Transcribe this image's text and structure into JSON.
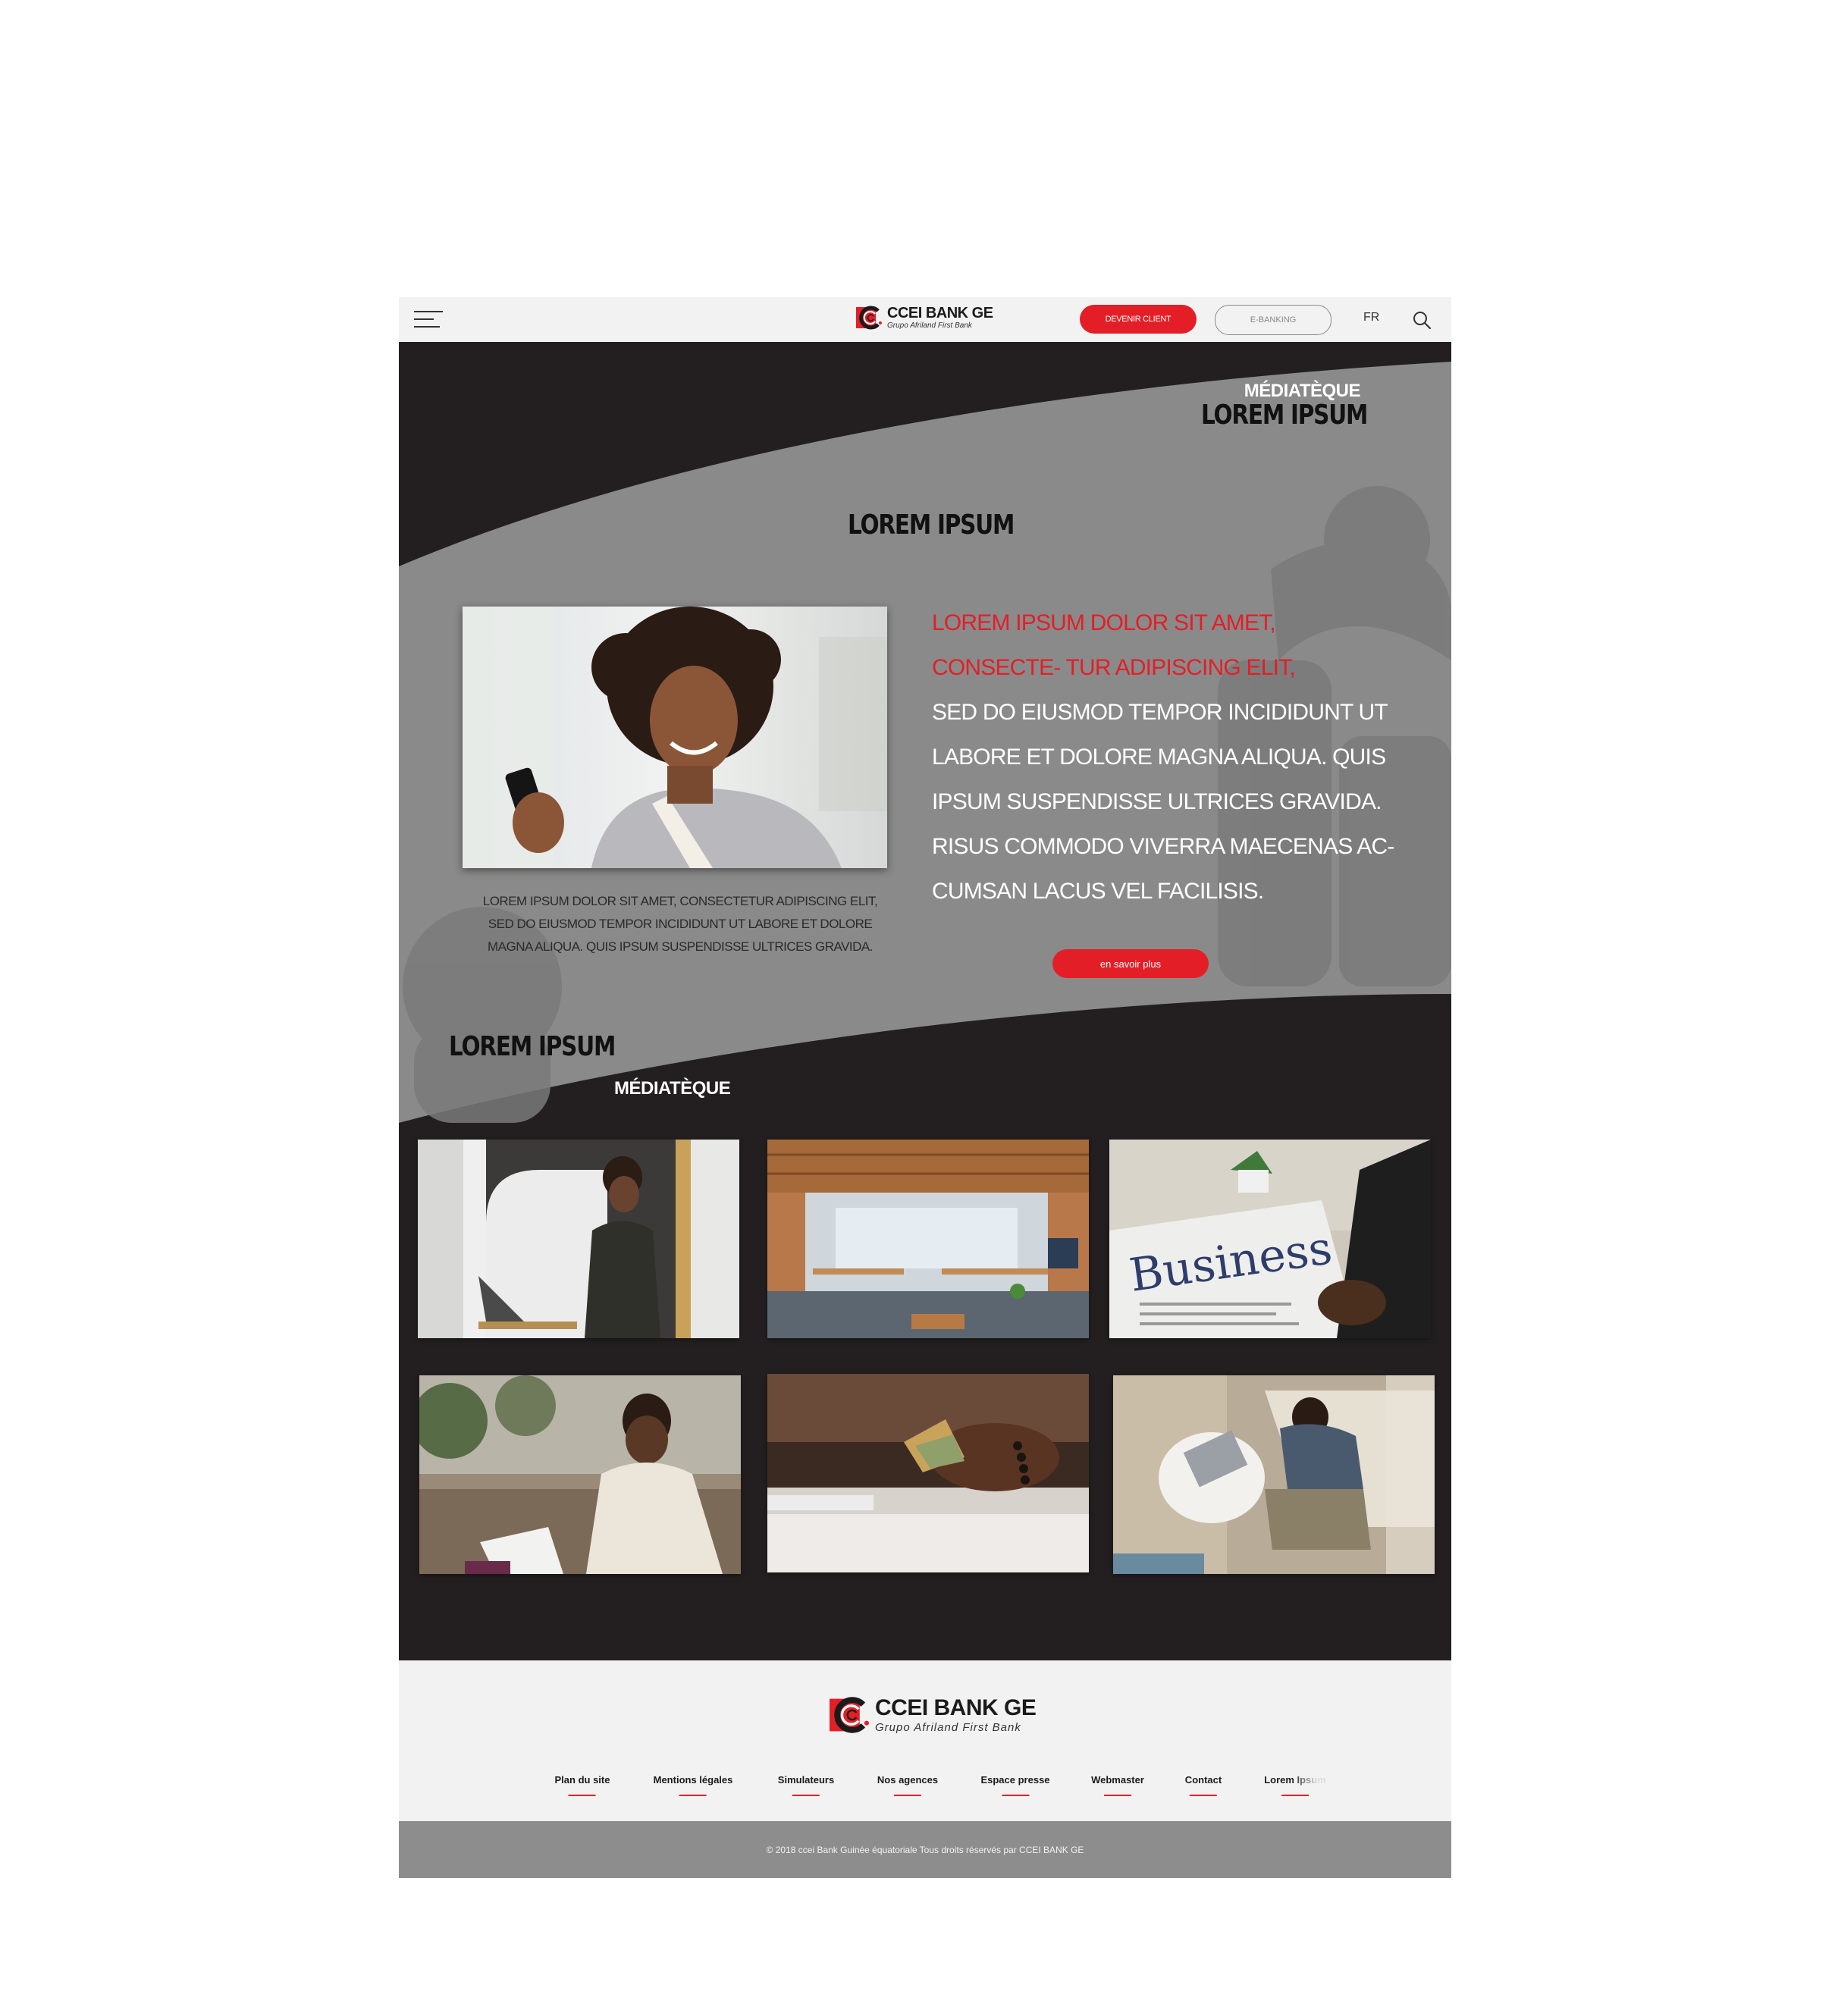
{
  "colors": {
    "brand_red": "#e41e26",
    "dark": "#231f20",
    "grey": "#8a8a8a",
    "light": "#f2f2f2"
  },
  "header": {
    "menu_icon": "hamburger-icon",
    "logo": {
      "title": "CCEI BANK GE",
      "subtitle": "Grupo Afriland First Bank"
    },
    "become_client_label": "DEVENIR CLIENT",
    "ebanking_label": "E-BANKING",
    "language": "FR",
    "search_icon": "search-icon"
  },
  "hero": {
    "kicker_top": "MÉDIATÈQUE",
    "heading_top": "LOREM IPSUM",
    "heading_center": "LOREM IPSUM",
    "caption": "LOREM IPSUM DOLOR SIT AMET, CONSECTETUR ADIPISCING ELIT, SED DO EIUSMOD TEMPOR INCIDIDUNT UT LABORE ET DOLORE MAGNA ALIQUA. QUIS IPSUM SUSPENDISSE ULTRICES GRAVIDA.",
    "lead_red": "LOREM IPSUM DOLOR SIT AMET, CONSECTE- TUR ADIPISCING ELIT,",
    "lead_white": "SED DO EIUSMOD TEMPOR INCIDIDUNT UT LABORE ET DOLORE MAGNA ALIQUA. QUIS IPSUM SUSPENDISSE ULTRICES GRAVIDA. RISUS COMMODO VIVERRA MAECENAS AC- CUMSAN LACUS VEL FACILISIS.",
    "cta_label": "en savoir plus"
  },
  "media": {
    "heading": "LOREM IPSUM",
    "kicker": "MÉDIATÈQUE",
    "items": [
      {
        "alt": "man-on-phone-with-laptop-photo"
      },
      {
        "alt": "open-office-photo"
      },
      {
        "alt": "business-newspaper-photo",
        "headline": "Business"
      },
      {
        "alt": "man-reading-outdoors-photo"
      },
      {
        "alt": "hands-counting-cash-photo"
      },
      {
        "alt": "man-with-laptop-on-sofa-photo"
      }
    ]
  },
  "footer": {
    "logo": {
      "title": "CCEI BANK GE",
      "subtitle": "Grupo Afriland First Bank"
    },
    "links": [
      "Plan du site",
      "Mentions légales",
      "Simulateurs",
      "Nos agences",
      "Espace presse",
      "Webmaster",
      "Contact",
      "Lorem Ipsum"
    ],
    "copyright": "© 2018 ccei Bank Guinée équatoriale Tous droits réservés par CCEI BANK GE"
  }
}
